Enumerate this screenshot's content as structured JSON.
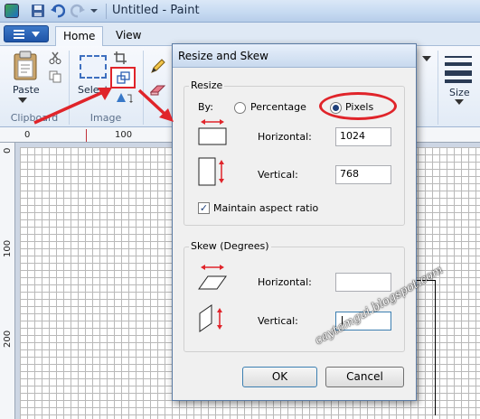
{
  "window": {
    "title": "Untitled - Paint"
  },
  "tabs": [
    {
      "label": "Home"
    },
    {
      "label": "View"
    }
  ],
  "ribbon": {
    "paste_label": "Paste",
    "select_label": "Select",
    "size_label": "Size",
    "groups": {
      "clipboard": "Clipboard",
      "image": "Image"
    }
  },
  "ruler": {
    "h_ticks": [
      "0",
      "100"
    ],
    "v_ticks": [
      "0",
      "100",
      "200"
    ]
  },
  "dialog": {
    "title": "Resize and Skew",
    "resize": {
      "legend": "Resize",
      "by_label": "By:",
      "options": [
        {
          "label": "Percentage",
          "selected": false
        },
        {
          "label": "Pixels",
          "selected": true
        }
      ],
      "horizontal_label": "Horizontal:",
      "horizontal_value": "1024",
      "vertical_label": "Vertical:",
      "vertical_value": "768",
      "maintain_label": "Maintain aspect ratio",
      "maintain_checked": true
    },
    "skew": {
      "legend": "Skew (Degrees)",
      "horizontal_label": "Horizontal:",
      "horizontal_value": "",
      "vertical_label": "Vertical:",
      "vertical_value": ""
    },
    "ok_label": "OK",
    "cancel_label": "Cancel"
  },
  "watermark": "caytamgui.blogspot.com",
  "colors": {
    "annotation_red": "#e0242a",
    "canvas_bg": "#cdd6e4",
    "ribbon_blue": "#1f55a8"
  }
}
